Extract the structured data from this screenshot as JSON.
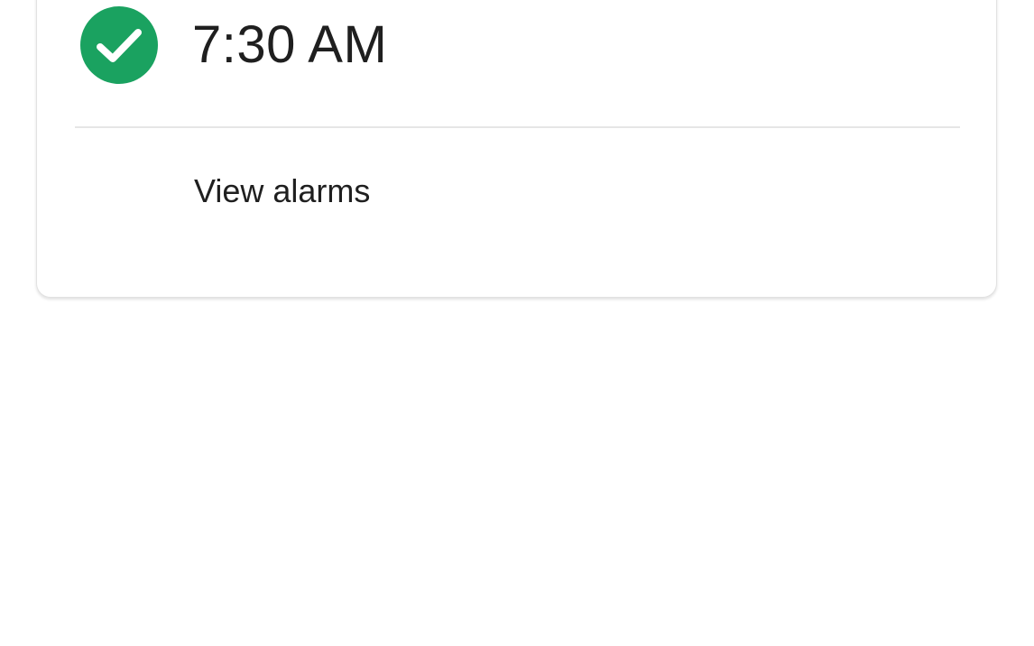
{
  "alarm": {
    "time": "7:30 AM",
    "status_icon": "check-circle-icon",
    "status_color": "#1aa260"
  },
  "actions": {
    "view_alarms_label": "View alarms"
  }
}
